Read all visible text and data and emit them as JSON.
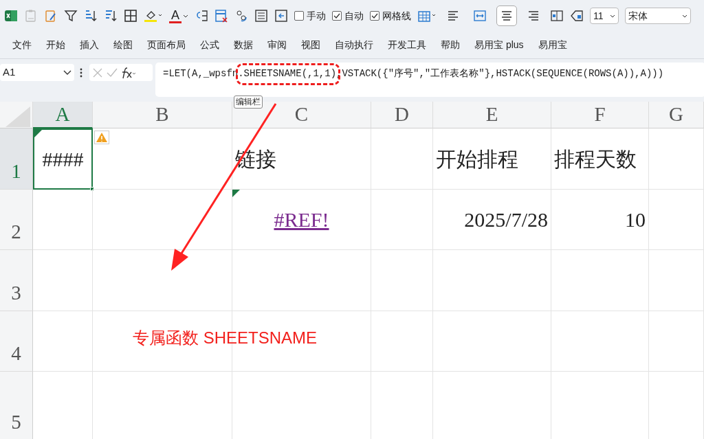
{
  "toolbar": {
    "font_color_label": "A",
    "checkboxes": [
      {
        "label": "手动",
        "checked": false
      },
      {
        "label": "自动",
        "checked": true
      },
      {
        "label": "网格线",
        "checked": true
      }
    ],
    "align_buttons": [
      {
        "kind": "left",
        "selected": false
      },
      {
        "kind": "merge",
        "selected": false
      },
      {
        "kind": "center",
        "selected": true
      },
      {
        "kind": "right",
        "selected": false
      }
    ],
    "font_size": "11",
    "font_name": "宋体"
  },
  "menu": [
    "文件",
    "开始",
    "插入",
    "绘图",
    "页面布局",
    "公式",
    "数据",
    "审阅",
    "视图",
    "自动执行",
    "开发工具",
    "帮助",
    "易用宝 plus",
    "易用宝"
  ],
  "name_box": "A1",
  "formula": "=LET(A,_wpsfn.SHEETSNAME(,1,1),VSTACK({\"序号\",\"工作表名称\"},HSTACK(SEQUENCE(ROWS(A)),A)))",
  "tooltip": "编辑栏",
  "columns": [
    {
      "label": "A",
      "selected": true
    },
    {
      "label": "B",
      "selected": false
    },
    {
      "label": "C",
      "selected": false
    },
    {
      "label": "D",
      "selected": false
    },
    {
      "label": "E",
      "selected": false
    },
    {
      "label": "F",
      "selected": false
    },
    {
      "label": "G",
      "selected": false
    }
  ],
  "rows": [
    {
      "header": "1",
      "selected": true,
      "column_1": {
        "text": "####",
        "kind": "error",
        "error_flag": true,
        "active": true
      },
      "column_3": {
        "text": "链接",
        "kind": "text"
      },
      "column_5": {
        "text": "开始排程",
        "kind": "text"
      },
      "column_6": {
        "text": "排程天数",
        "kind": "text"
      }
    },
    {
      "header": "2",
      "selected": false,
      "column_3": {
        "text": "#REF!",
        "kind": "link",
        "error_flag": true
      },
      "column_5": {
        "text": "2025/7/28",
        "kind": "number"
      },
      "column_6": {
        "text": "10",
        "kind": "number"
      }
    },
    {
      "header": "3",
      "selected": false
    },
    {
      "header": "4",
      "selected": false
    },
    {
      "header": "5",
      "selected": false
    }
  ],
  "annotation": {
    "text": "专属函数 SHEETSNAME"
  }
}
